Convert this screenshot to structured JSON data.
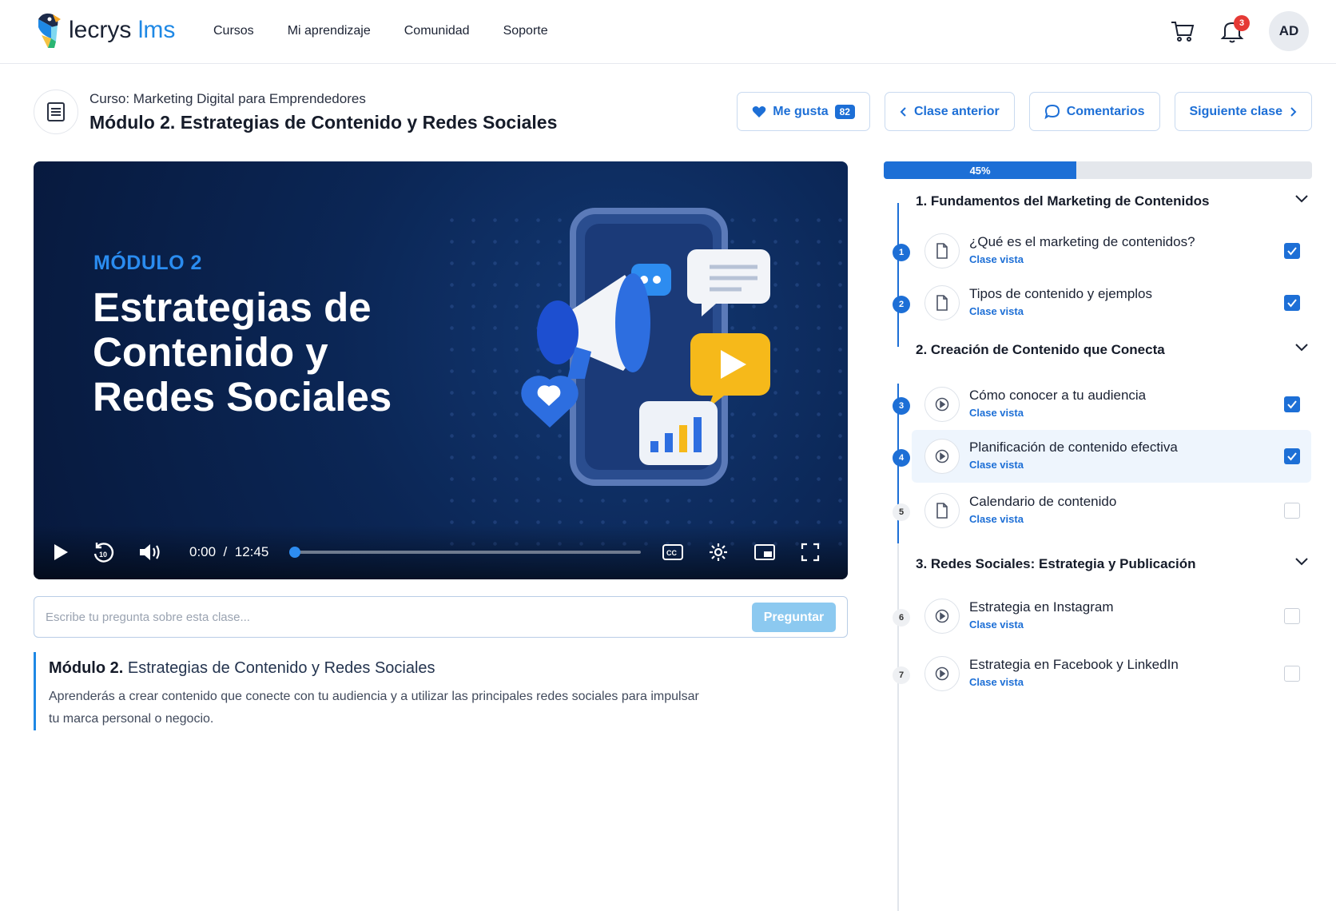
{
  "brand": {
    "name_part1": "lecrys",
    "name_part2": "lms"
  },
  "nav": {
    "items": [
      "Cursos",
      "Mi aprendizaje",
      "Comunidad",
      "Soporte"
    ]
  },
  "topbar": {
    "notification_count": "3",
    "avatar_initials": "AD"
  },
  "header": {
    "course_line": "Curso: Marketing Digital para Emprendedores",
    "module_title": "Módulo 2. Estrategias de Contenido y Redes Sociales"
  },
  "actions": {
    "like_label": "Me gusta",
    "like_count": "82",
    "prev_label": "Clase anterior",
    "comments_label": "Comentarios",
    "next_label": "Siguiente clase"
  },
  "video": {
    "kicker": "MÓDULO 2",
    "title": "Estrategias de Contenido y Redes Sociales",
    "current_time": "0:00",
    "separator": "/",
    "duration": "12:45",
    "seek_fraction": 0.0
  },
  "ask": {
    "placeholder": "Escribe tu pregunta sobre esta clase...",
    "button_label": "Preguntar"
  },
  "description": {
    "module_prefix": "Módulo 2.",
    "module_name": "Estrategias de Contenido y Redes Sociales",
    "text": "Aprenderás a crear contenido que conecte con tu audiencia y a utilizar las principales redes sociales para impulsar tu marca personal o negocio."
  },
  "progress": {
    "label": "45%",
    "fraction": 0.45
  },
  "sections": [
    {
      "title": "1. Fundamentos del Marketing de Contenidos"
    },
    {
      "title": "2. Creación de Contenido que Conecta"
    },
    {
      "title": "3. Redes Sociales: Estrategia y Publicación"
    }
  ],
  "lessons": [
    {
      "num": "1",
      "title": "¿Qué es el marketing de contenidos?",
      "status": "Clase vista",
      "icon": "document-icon",
      "checked": true
    },
    {
      "num": "2",
      "title": "Tipos de contenido y ejemplos",
      "status": "Clase vista",
      "icon": "document-icon",
      "checked": true
    },
    {
      "num": "3",
      "title": "Cómo conocer a tu audiencia",
      "status": "Clase vista",
      "icon": "play-circle-icon",
      "checked": true
    },
    {
      "num": "4",
      "title": "Planificación de contenido efectiva",
      "status": "Clase vista",
      "icon": "play-circle-icon",
      "checked": true
    },
    {
      "num": "5",
      "title": "Calendario de contenido",
      "status": "Clase vista",
      "icon": "document-icon",
      "checked": false
    },
    {
      "num": "6",
      "title": "Estrategia en Instagram",
      "status": "Clase vista",
      "icon": "play-circle-icon",
      "checked": false
    },
    {
      "num": "7",
      "title": "Estrategia en Facebook y LinkedIn",
      "status": "Clase vista",
      "icon": "play-circle-icon",
      "checked": false
    }
  ],
  "colors": {
    "accent": "#1d6fd6",
    "video_bg": "#0b2655",
    "kicker": "#2a8cf0"
  }
}
